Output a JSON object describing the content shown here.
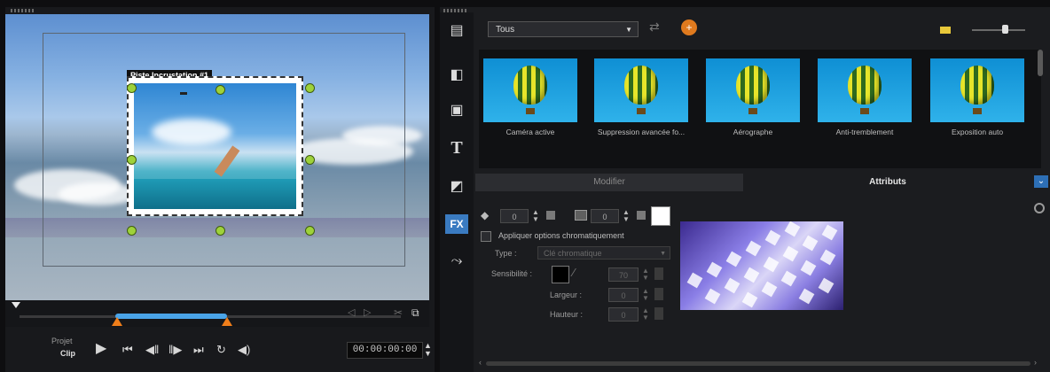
{
  "preview": {
    "overlay_label": "Piste Incrustation #1",
    "project_label": "Projet",
    "clip_label": "Clip",
    "timecode": "00:00:00:00"
  },
  "library": {
    "category": "Tous",
    "thumbnails": [
      {
        "caption": "Caméra active"
      },
      {
        "caption": "Suppression avancée fo..."
      },
      {
        "caption": "Aérographe"
      },
      {
        "caption": "Anti-tremblement"
      },
      {
        "caption": "Exposition auto"
      }
    ],
    "tabs": {
      "modifier": "Modifier",
      "attributes": "Attributs"
    }
  },
  "attributes": {
    "spin1_value": "0",
    "spin2_value": "0",
    "apply_mask_label": "Appliquer options chromatiquement",
    "type_label": "Type :",
    "type_value": "Clé chromatique",
    "sensitivity_label": "Sensibilité :",
    "width_label": "Largeur :",
    "height_label": "Hauteur :",
    "sensitivity_value": "70",
    "width_value": "0",
    "height_value": "0"
  },
  "colors": {
    "accent": "#3a7bc1",
    "trim_handle": "#f07e1a",
    "trim_range": "#4aa4e8",
    "selection_handle": "#9ed23a"
  }
}
